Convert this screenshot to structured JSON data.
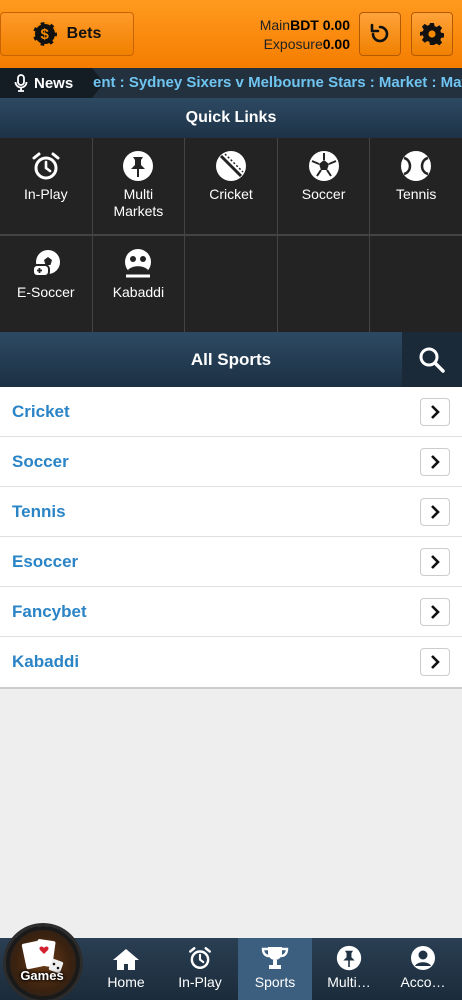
{
  "header": {
    "bets_label": "Bets",
    "main_label": "Main",
    "main_value": "BDT 0.00",
    "exposure_label": "Exposure",
    "exposure_value": "0.00"
  },
  "news": {
    "label": "News",
    "text": "ent : Sydney Sixers v Melbourne Stars : Market : Match"
  },
  "quick_links": {
    "title": "Quick Links",
    "items": [
      {
        "label": "In-Play",
        "icon": "alarm-clock-icon"
      },
      {
        "label": "Multi Markets",
        "icon": "pin-icon"
      },
      {
        "label": "Cricket",
        "icon": "cricket-ball-icon"
      },
      {
        "label": "Soccer",
        "icon": "soccer-ball-icon"
      },
      {
        "label": "Tennis",
        "icon": "tennis-ball-icon"
      },
      {
        "label": "E-Soccer",
        "icon": "esoccer-icon"
      },
      {
        "label": "Kabaddi",
        "icon": "kabaddi-icon"
      }
    ]
  },
  "all_sports": {
    "title": "All Sports",
    "items": [
      "Cricket",
      "Soccer",
      "Tennis",
      "Esoccer",
      "Fancybet",
      "Kabaddi"
    ]
  },
  "bottom_nav": {
    "games_label": "Games",
    "items": [
      {
        "label": "Home",
        "icon": "home-icon"
      },
      {
        "label": "In-Play",
        "icon": "alarm-clock-icon"
      },
      {
        "label": "Sports",
        "icon": "trophy-icon"
      },
      {
        "label": "Multi…",
        "icon": "pin-icon"
      },
      {
        "label": "Acco…",
        "icon": "user-icon"
      }
    ],
    "active": "Sports"
  },
  "colors": {
    "header_orange": "#f58a00",
    "navy": "#23313f",
    "link_blue": "#2a84c6"
  }
}
